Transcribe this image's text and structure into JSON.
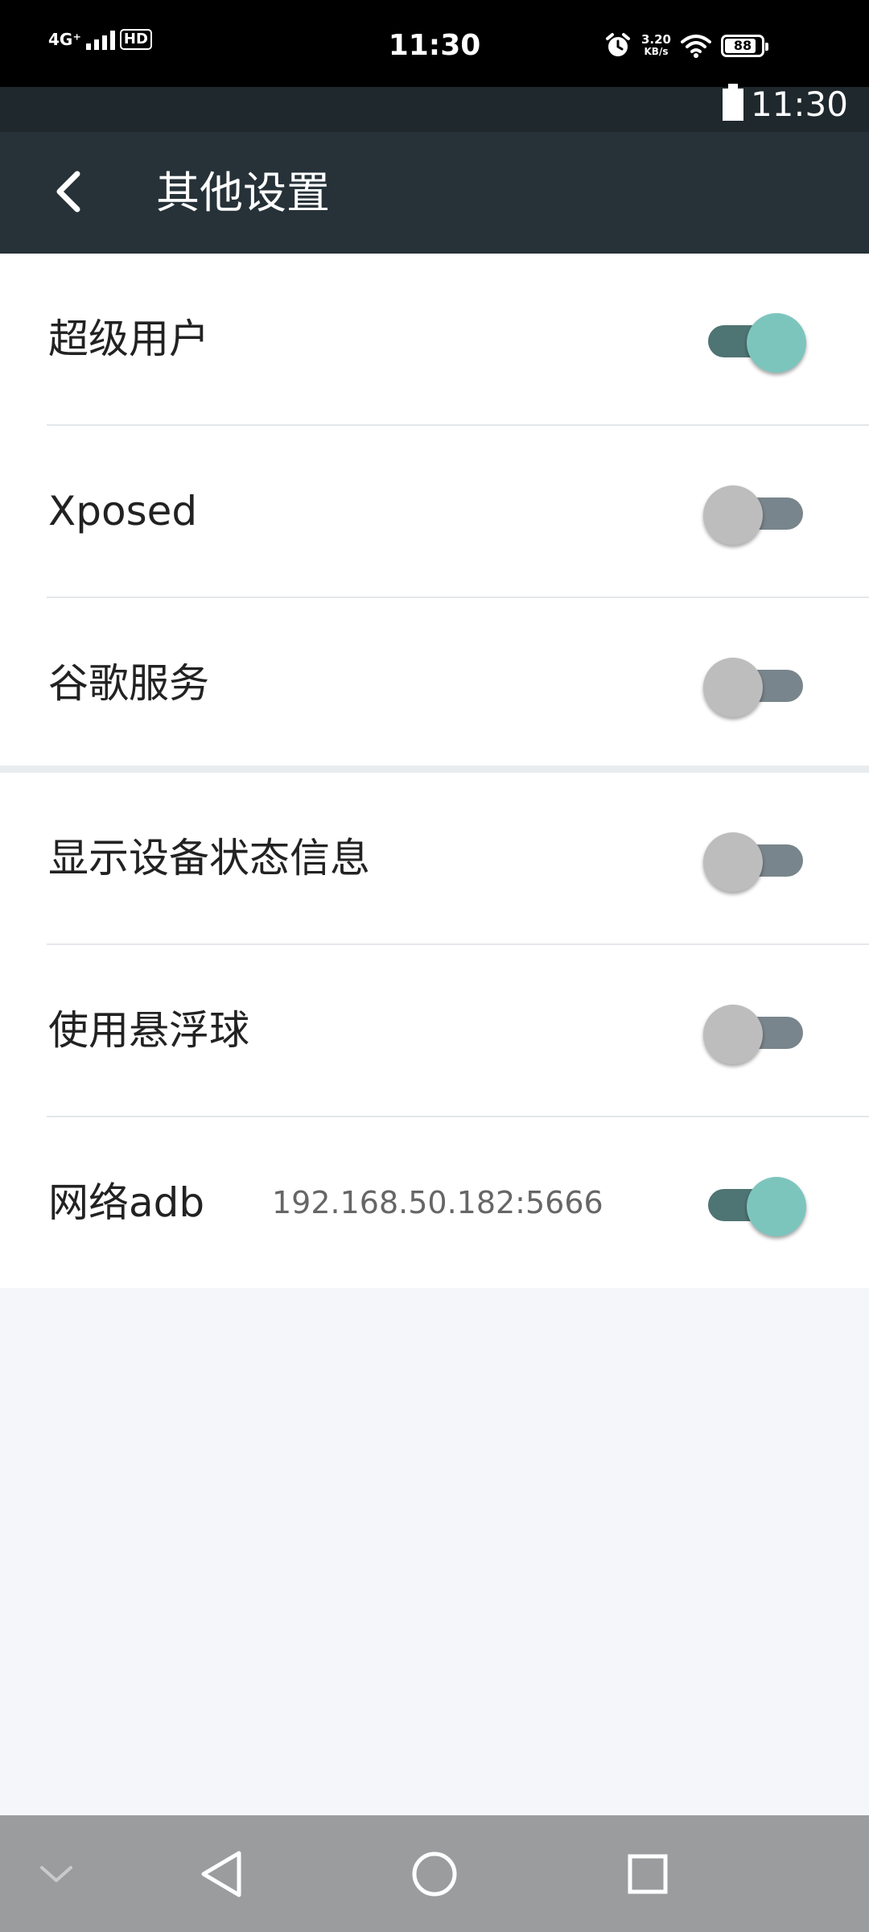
{
  "status_bar": {
    "network": "4G⁺",
    "hd_badge": "HD",
    "time": "11:30",
    "speed_value": "3.20",
    "speed_unit": "KB/s",
    "battery_level": "88",
    "battery_percent": 88,
    "icons": [
      "signal-icon",
      "alarm-icon",
      "wifi-icon",
      "battery-icon"
    ]
  },
  "secondary_status": {
    "time": "11:30",
    "icons": [
      "battery-icon"
    ]
  },
  "toolbar": {
    "back_icon": "back-arrow-icon",
    "title": "其他设置"
  },
  "settings_groups": [
    {
      "items": [
        {
          "label": "超级用户",
          "enabled": true
        },
        {
          "label": "Xposed",
          "enabled": false
        },
        {
          "label": "谷歌服务",
          "enabled": false
        }
      ]
    },
    {
      "items": [
        {
          "label": "显示设备状态信息",
          "enabled": false
        },
        {
          "label": "使用悬浮球",
          "enabled": false
        },
        {
          "label": "网络adb",
          "value": "192.168.50.182:5666",
          "enabled": true
        }
      ]
    }
  ],
  "nav_bar": {
    "items": [
      "collapse-chevron-icon",
      "back-triangle-icon",
      "home-circle-icon",
      "recents-square-icon"
    ]
  },
  "colors": {
    "toolbar": "#263238",
    "switch_on_thumb": "#7cc5bd",
    "switch_on_track": "#4f7474",
    "switch_off_thumb": "#bdbdbd",
    "switch_off_track": "#79858c"
  }
}
